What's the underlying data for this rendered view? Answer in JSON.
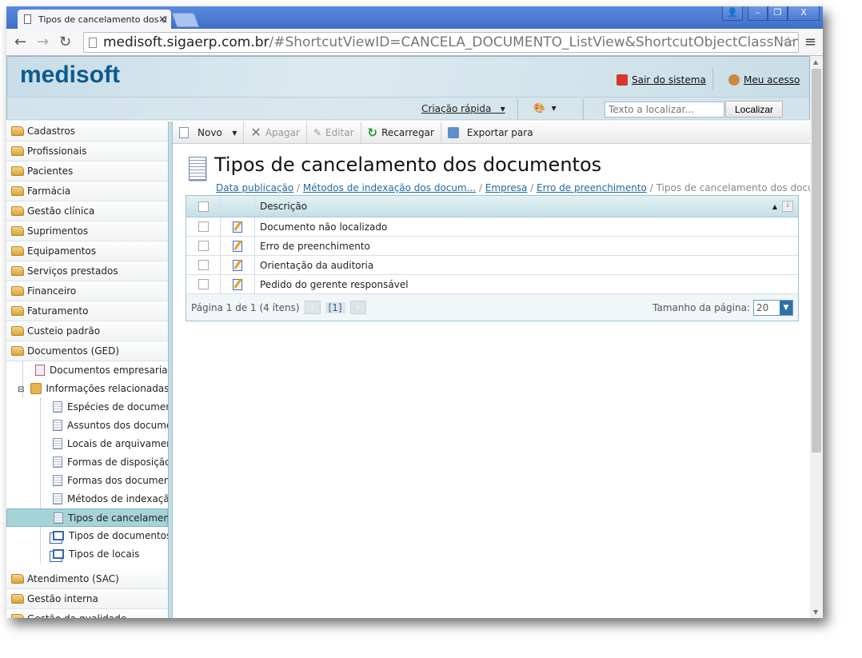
{
  "browser": {
    "tab_title": "Tipos de cancelamento dos d",
    "url_host": "medisoft.sigaerp.com.br",
    "url_rest": "/#ShortcutViewID=CANCELA_DOCUMENTO_ListView&ShortcutObjectClassName=Medisoft.Mod"
  },
  "header": {
    "logo": "medisoft",
    "logout": "Sair do sistema",
    "my_access": "Meu acesso",
    "quick_create": "Criação rápida",
    "search_placeholder": "Texto a localizar...",
    "search_button": "Localizar"
  },
  "toolbar": {
    "new": "Novo",
    "delete": "Apagar",
    "edit": "Editar",
    "reload": "Recarregar",
    "export": "Exportar para"
  },
  "sidebar": {
    "groups_top": [
      "Cadastros",
      "Profissionais",
      "Pacientes",
      "Farmácia",
      "Gestão clínica",
      "Suprimentos",
      "Equipamentos",
      "Serviços prestados",
      "Financeiro",
      "Faturamento",
      "Custeio padrão",
      "Documentos (GED)"
    ],
    "tree": {
      "documentos_empresariais": "Documentos empresariais",
      "info_relacionadas": "Informações relacionadas",
      "children": [
        "Espécies de documentos",
        "Assuntos dos documentos",
        "Locais de arquivamento",
        "Formas de disposição",
        "Formas dos documentos",
        "Métodos de indexação",
        "Tipos de cancelamento",
        "Tipos de documentos",
        "Tipos de locais"
      ]
    },
    "groups_bottom": [
      "Atendimento (SAC)",
      "Gestão interna",
      "Gestão da qualidade"
    ]
  },
  "page": {
    "title": "Tipos de cancelamento dos documentos",
    "breadcrumb": [
      "Data publicação",
      "Métodos de indexação dos docum...",
      "Empresa",
      "Erro de preenchimento"
    ],
    "breadcrumb_current": "Tipos de cancelamento dos docu..."
  },
  "grid": {
    "column": "Descrição",
    "rows": [
      "Documento não localizado",
      "Erro de preenchimento",
      "Orientação da auditoria",
      "Pedido do gerente responsável"
    ],
    "pager_text": "Página 1 de 1 (4 ítens)",
    "current_page": "[1]",
    "page_size_label": "Tamanho da página:",
    "page_size": "20"
  }
}
